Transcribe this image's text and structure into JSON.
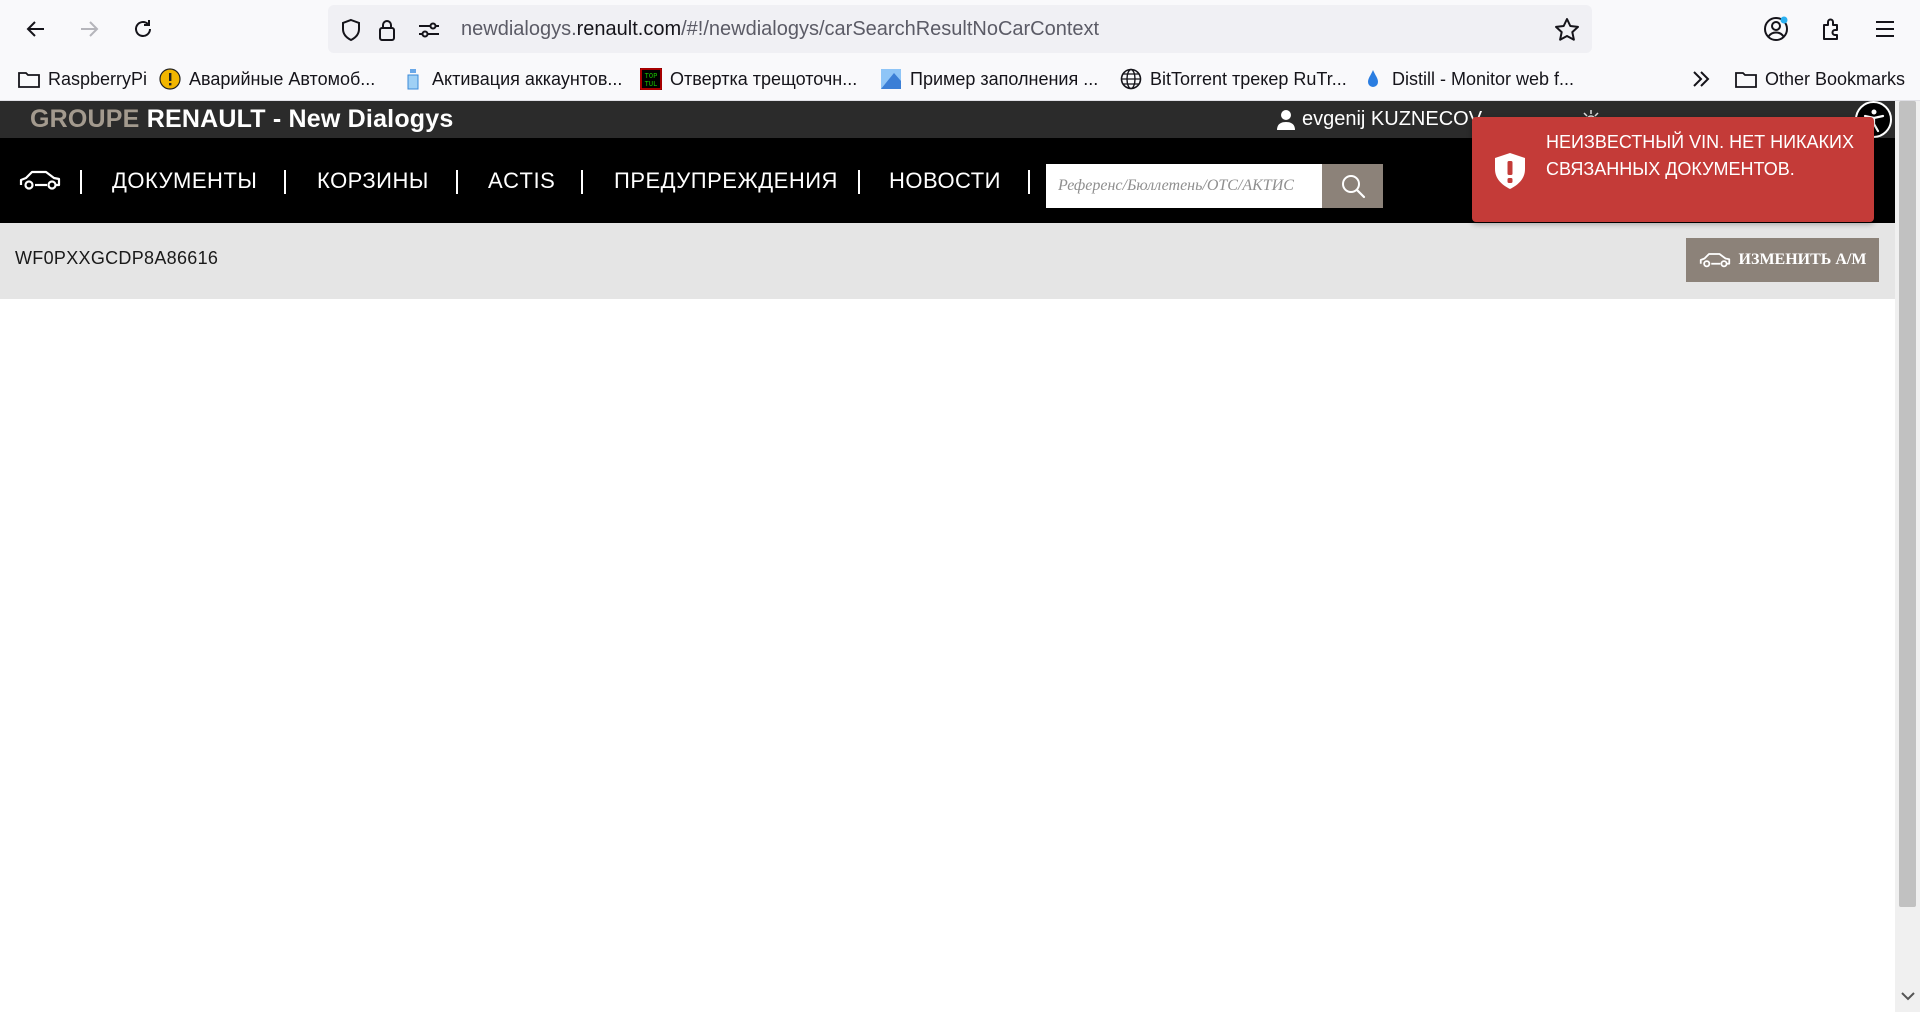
{
  "browser": {
    "url_prefix": "newdialogys.",
    "url_domain": "renault.com",
    "url_path": "/#!/newdialogys/carSearchResultNoCarContext"
  },
  "bookmarks": [
    {
      "label": "RaspberryPi",
      "icon": "folder-icon"
    },
    {
      "label": "Аварийные Автомоб...",
      "icon": "warning-icon"
    },
    {
      "label": "Активация аккаунтов...",
      "icon": "bottle-icon"
    },
    {
      "label": "Отвертка трещоточн...",
      "icon": "toptul-icon"
    },
    {
      "label": "Пример заполнения ...",
      "icon": "image-icon"
    },
    {
      "label": "BitTorrent трекер RuTr...",
      "icon": "globe-icon"
    },
    {
      "label": "Distill - Monitor web f...",
      "icon": "drop-icon"
    }
  ],
  "bookmarks_other": "Other Bookmarks",
  "header": {
    "brand_groupe": "GROUPE",
    "brand_renault": " RENAULT - ",
    "brand_app": " New Dialogys",
    "user_name": "evgenij KUZNECOV"
  },
  "nav": {
    "documents": "ДОКУМЕНТЫ",
    "baskets": "КОРЗИНЫ",
    "actis": "ACTIS",
    "warnings": "ПРЕДУПРЕЖДЕНИЯ",
    "news": "НОВОСТИ",
    "search_placeholder": "Референс/Бюллетень/OTC/АКТИС"
  },
  "vehicle": {
    "vin": "WF0PXXGCDP8A86616",
    "change_label": "ИЗМЕНИТЬ А/М"
  },
  "toast": {
    "message": "НЕИЗВЕСТНЫЙ VIN. НЕТ НИКАКИХ СВЯЗАННЫХ ДОКУМЕНТОВ.",
    "color": "#c43b38"
  },
  "colors": {
    "topbar": "#2b2b2b",
    "nav": "#000000",
    "accent": "#8c8279",
    "vinbar": "#e5e5e5"
  }
}
